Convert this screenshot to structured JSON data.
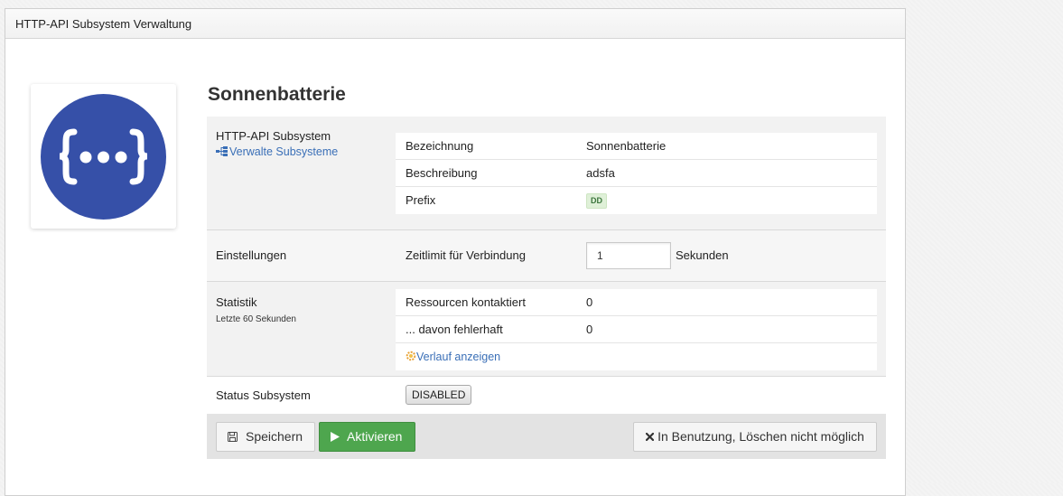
{
  "panel": {
    "title": "HTTP-API Subsystem Verwaltung"
  },
  "subsystem": {
    "name": "Sonnenbatterie"
  },
  "info": {
    "label": "HTTP-API Subsystem",
    "manage_link": "Verwalte Subsysteme",
    "rows": [
      {
        "key": "Bezeichnung",
        "value": "Sonnenbatterie"
      },
      {
        "key": "Beschreibung",
        "value": "adsfa"
      },
      {
        "key": "Prefix",
        "value": "DD"
      }
    ]
  },
  "settings": {
    "label": "Einstellungen",
    "timeout_label": "Zeitlimit für Verbindung",
    "timeout_value": "1",
    "timeout_unit": "Sekunden"
  },
  "statistics": {
    "label": "Statistik",
    "sublabel": "Letzte 60 Sekunden",
    "rows": [
      {
        "key": "Ressourcen kontaktiert",
        "value": "0"
      },
      {
        "key": "... davon fehlerhaft",
        "value": "0"
      }
    ],
    "history_link": "Verlauf anzeigen"
  },
  "status": {
    "label": "Status Subsystem",
    "value": "DISABLED"
  },
  "actions": {
    "save_label": "Speichern",
    "activate_label": "Aktivieren",
    "delete_label": "In Benutzung, Löschen nicht möglich"
  },
  "colors": {
    "logo_bg": "#3650a8",
    "success": "#4ea64e",
    "link": "#3a6fb7",
    "prefix_badge_bg": "#dff0d8"
  },
  "icons": {
    "logo": "curly-braces-ellipsis-icon",
    "manage": "sitemap-icon",
    "history": "history-gear-icon",
    "save": "floppy-disk-icon",
    "activate": "play-icon",
    "delete": "close-icon"
  }
}
